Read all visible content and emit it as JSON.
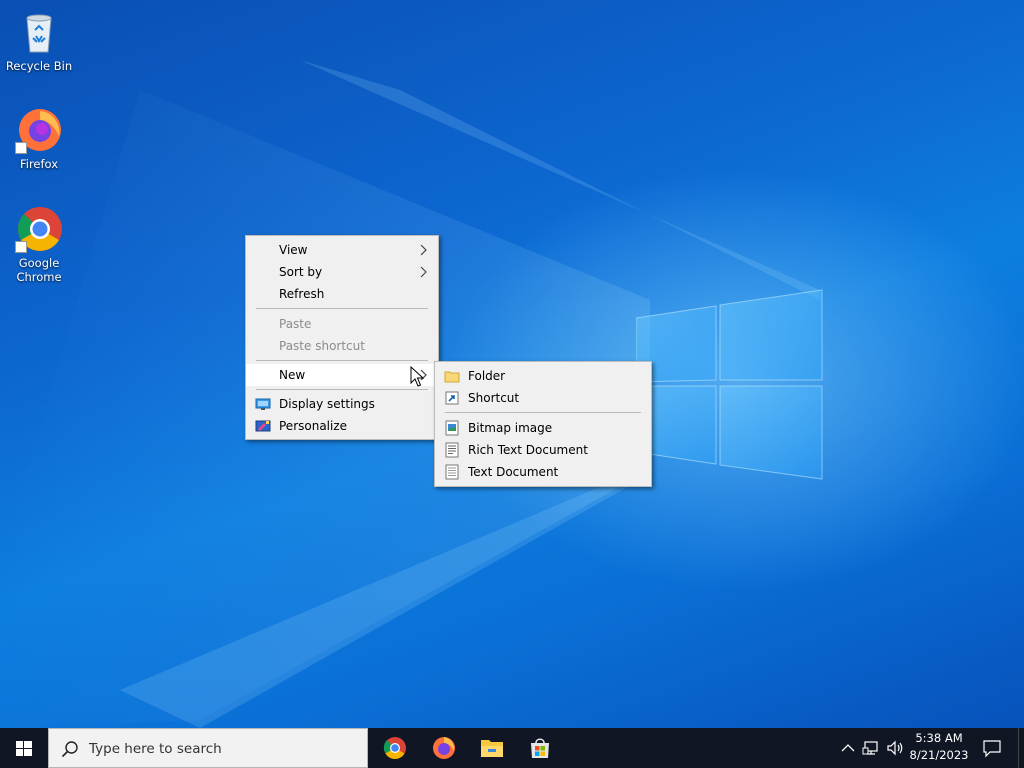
{
  "desktop_icons": [
    {
      "label": "Recycle Bin",
      "icon": "recycle-bin-icon"
    },
    {
      "label": "Firefox",
      "icon": "firefox-icon"
    },
    {
      "label": "Google Chrome",
      "icon": "chrome-icon"
    }
  ],
  "context_menu": {
    "items": [
      {
        "label": "View",
        "submenu": true
      },
      {
        "label": "Sort by",
        "submenu": true
      },
      {
        "label": "Refresh"
      },
      {
        "label": "Paste",
        "disabled": true
      },
      {
        "label": "Paste shortcut",
        "disabled": true
      },
      {
        "label": "New",
        "submenu": true,
        "highlighted": true
      },
      {
        "label": "Display settings",
        "icon": "display-settings-icon"
      },
      {
        "label": "Personalize",
        "icon": "personalize-icon"
      }
    ]
  },
  "new_submenu": {
    "items": [
      {
        "label": "Folder",
        "icon": "folder-icon"
      },
      {
        "label": "Shortcut",
        "icon": "shortcut-icon"
      },
      {
        "label": "Bitmap image",
        "icon": "bitmap-icon"
      },
      {
        "label": "Rich Text Document",
        "icon": "rich-text-icon"
      },
      {
        "label": "Text Document",
        "icon": "text-document-icon"
      }
    ]
  },
  "taskbar": {
    "search_placeholder": "Type here to search",
    "pinned_apps": [
      "chrome-icon",
      "firefox-icon",
      "file-explorer-icon",
      "microsoft-store-icon"
    ],
    "tray_icons": [
      "chevron-up-icon",
      "network-icon",
      "volume-icon"
    ],
    "time": "5:38 AM",
    "date": "8/21/2023"
  },
  "colors": {
    "taskbar_bg": "#101624",
    "menu_bg": "#f0f0f0",
    "accent_blue": "#0a6fd6"
  }
}
